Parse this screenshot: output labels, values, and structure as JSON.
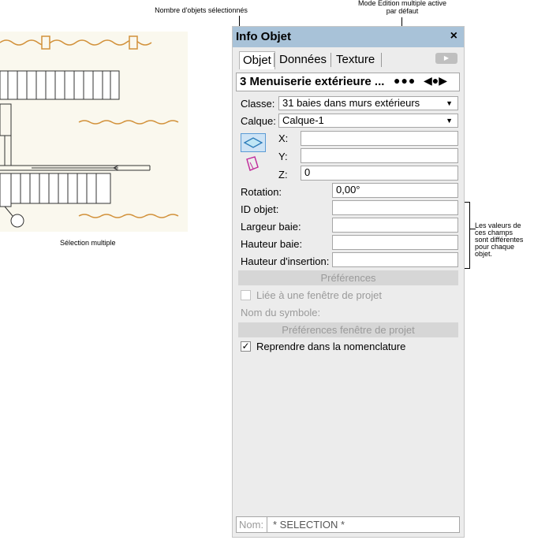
{
  "annotations": {
    "selected_count_label": "Nombre d'objets sélectionnés",
    "multi_edit_line1": "Mode Edition multiple active",
    "multi_edit_line2": "par défaut",
    "fields_note": [
      "Les valeurs de",
      "ces champs",
      "sont différentes",
      "pour chaque",
      "objet."
    ],
    "drawing_caption": "Sélection multiple"
  },
  "panel": {
    "title": "Info Objet",
    "close_glyph": "×",
    "tabs": [
      "Objet",
      "Données",
      "Texture"
    ],
    "type_label": "3 Menuiserie extérieure ...",
    "multi_dots": "●●●",
    "nav_glyph": "◀●▶",
    "classe": {
      "label": "Classe:",
      "value": "31 baies dans murs extérieurs"
    },
    "calque": {
      "label": "Calque:",
      "value": "Calque-1"
    },
    "x": {
      "label": "X:",
      "value": ""
    },
    "y": {
      "label": "Y:",
      "value": ""
    },
    "z": {
      "label": "Z:",
      "value": "0"
    },
    "rotation": {
      "label": "Rotation:",
      "value": "0,00°"
    },
    "id_objet": {
      "label": "ID objet:",
      "value": ""
    },
    "largeur": {
      "label": "Largeur baie:",
      "value": ""
    },
    "hauteur": {
      "label": "Hauteur baie:",
      "value": ""
    },
    "hauteur_insertion": {
      "label": "Hauteur d'insertion:",
      "value": ""
    },
    "preferences_btn": "Préférences",
    "liee_checkbox": "Liée à une fenêtre de projet",
    "nom_symbole_label": "Nom du symbole:",
    "pref_fenetre_btn": "Préférences fenêtre de projet",
    "reprendre_checkbox": "Reprendre dans la nomenclature",
    "reprendre_checked": true,
    "nom_label": "Nom:",
    "nom_value": "* SELECTION *",
    "colors": {
      "titlebar": "#a8c2d8",
      "drawing_bg": "#faf8ee",
      "window_line": "#d2913a"
    },
    "icons": [
      "plane-3d-icon",
      "plane-2d-icon",
      "dropdown-arrow-icon",
      "checkbox-icon"
    ]
  }
}
